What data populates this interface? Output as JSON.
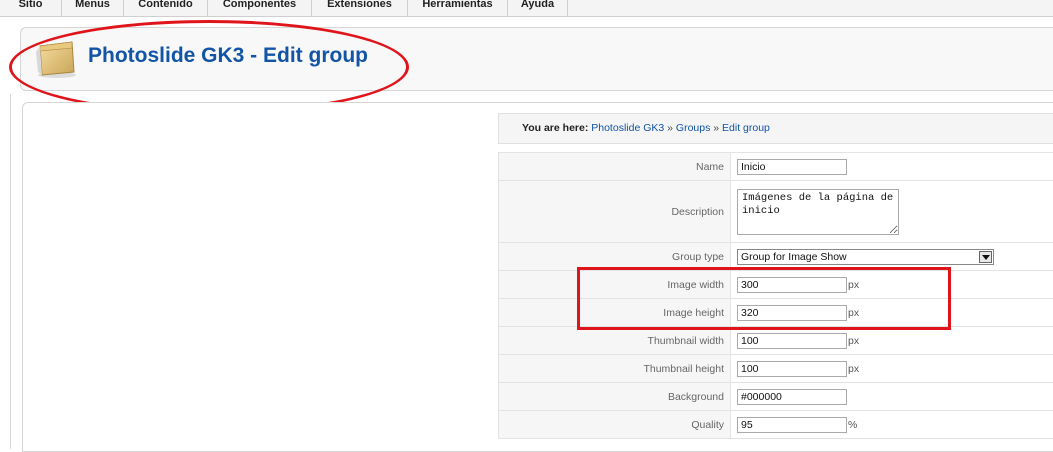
{
  "menu": {
    "items": [
      "Sitio",
      "Menus",
      "Contenido",
      "Componentes",
      "Extensiones",
      "Herramientas",
      "Ayuda"
    ]
  },
  "header": {
    "title": "Photoslide GK3 - Edit group",
    "icon": "box-icon"
  },
  "breadcrumb": {
    "label": "You are here:",
    "items": [
      "Photoslide GK3",
      "Groups",
      "Edit group"
    ],
    "separator": "»"
  },
  "form": {
    "name": {
      "label": "Name",
      "value": "Inicio"
    },
    "description": {
      "label": "Description",
      "value": "Imágenes de la página de inicio"
    },
    "group_type": {
      "label": "Group type",
      "value": "Group for Image Show"
    },
    "image_width": {
      "label": "Image width",
      "value": "300",
      "unit": "px"
    },
    "image_height": {
      "label": "Image height",
      "value": "320",
      "unit": "px"
    },
    "thumbnail_width": {
      "label": "Thumbnail width",
      "value": "100",
      "unit": "px"
    },
    "thumbnail_height": {
      "label": "Thumbnail height",
      "value": "100",
      "unit": "px"
    },
    "background": {
      "label": "Background",
      "value": "#000000"
    },
    "quality": {
      "label": "Quality",
      "value": "95",
      "unit": "%"
    }
  },
  "colors": {
    "title": "#1254a6",
    "link": "#1254a6",
    "annotation": "#e0151b"
  }
}
